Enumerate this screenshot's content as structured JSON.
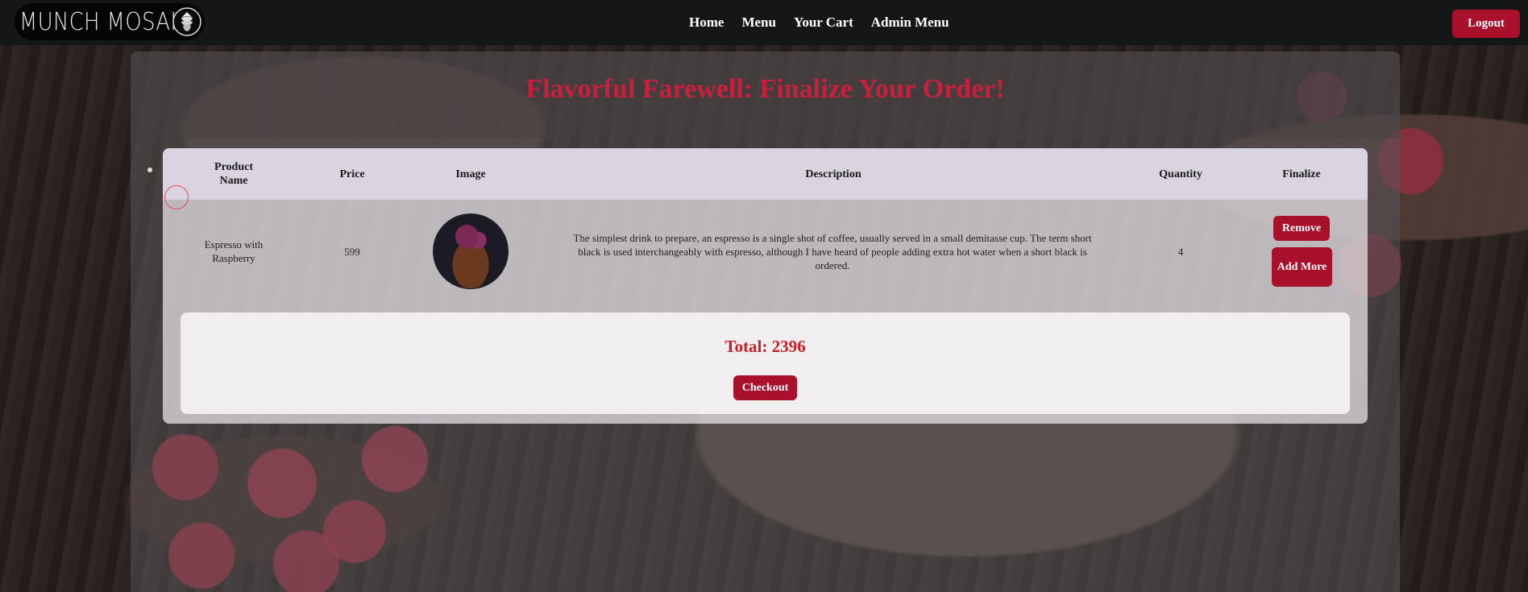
{
  "brand": {
    "name": "MUNCH MOSAIC",
    "logo_icon": "hop-cone-icon"
  },
  "nav": {
    "links": [
      "Home",
      "Menu",
      "Your Cart",
      "Admin Menu"
    ],
    "logout_label": "Logout"
  },
  "page": {
    "title": "Flavorful Farewell: Finalize Your Order!"
  },
  "cart": {
    "columns": [
      "Product Name",
      "Price",
      "Image",
      "Description",
      "Quantity",
      "Finalize"
    ],
    "rows": [
      {
        "product_name": "Espresso with Raspberry",
        "price": "599",
        "image_icon": "espresso-dessert-image",
        "description": "The simplest drink to prepare, an espresso is a single shot of coffee, usually served in a small demitasse cup. The term short black is used interchangeably with espresso, although I have heard of people adding extra hot water when a short black is ordered.",
        "quantity": "4",
        "remove_label": "Remove",
        "add_more_label": "Add More"
      }
    ],
    "total_label": "Total: 2396",
    "checkout_label": "Checkout"
  },
  "colors": {
    "accent": "#a8102b",
    "title": "#c8203c",
    "total": "#c62029",
    "navbar": "#151616"
  }
}
